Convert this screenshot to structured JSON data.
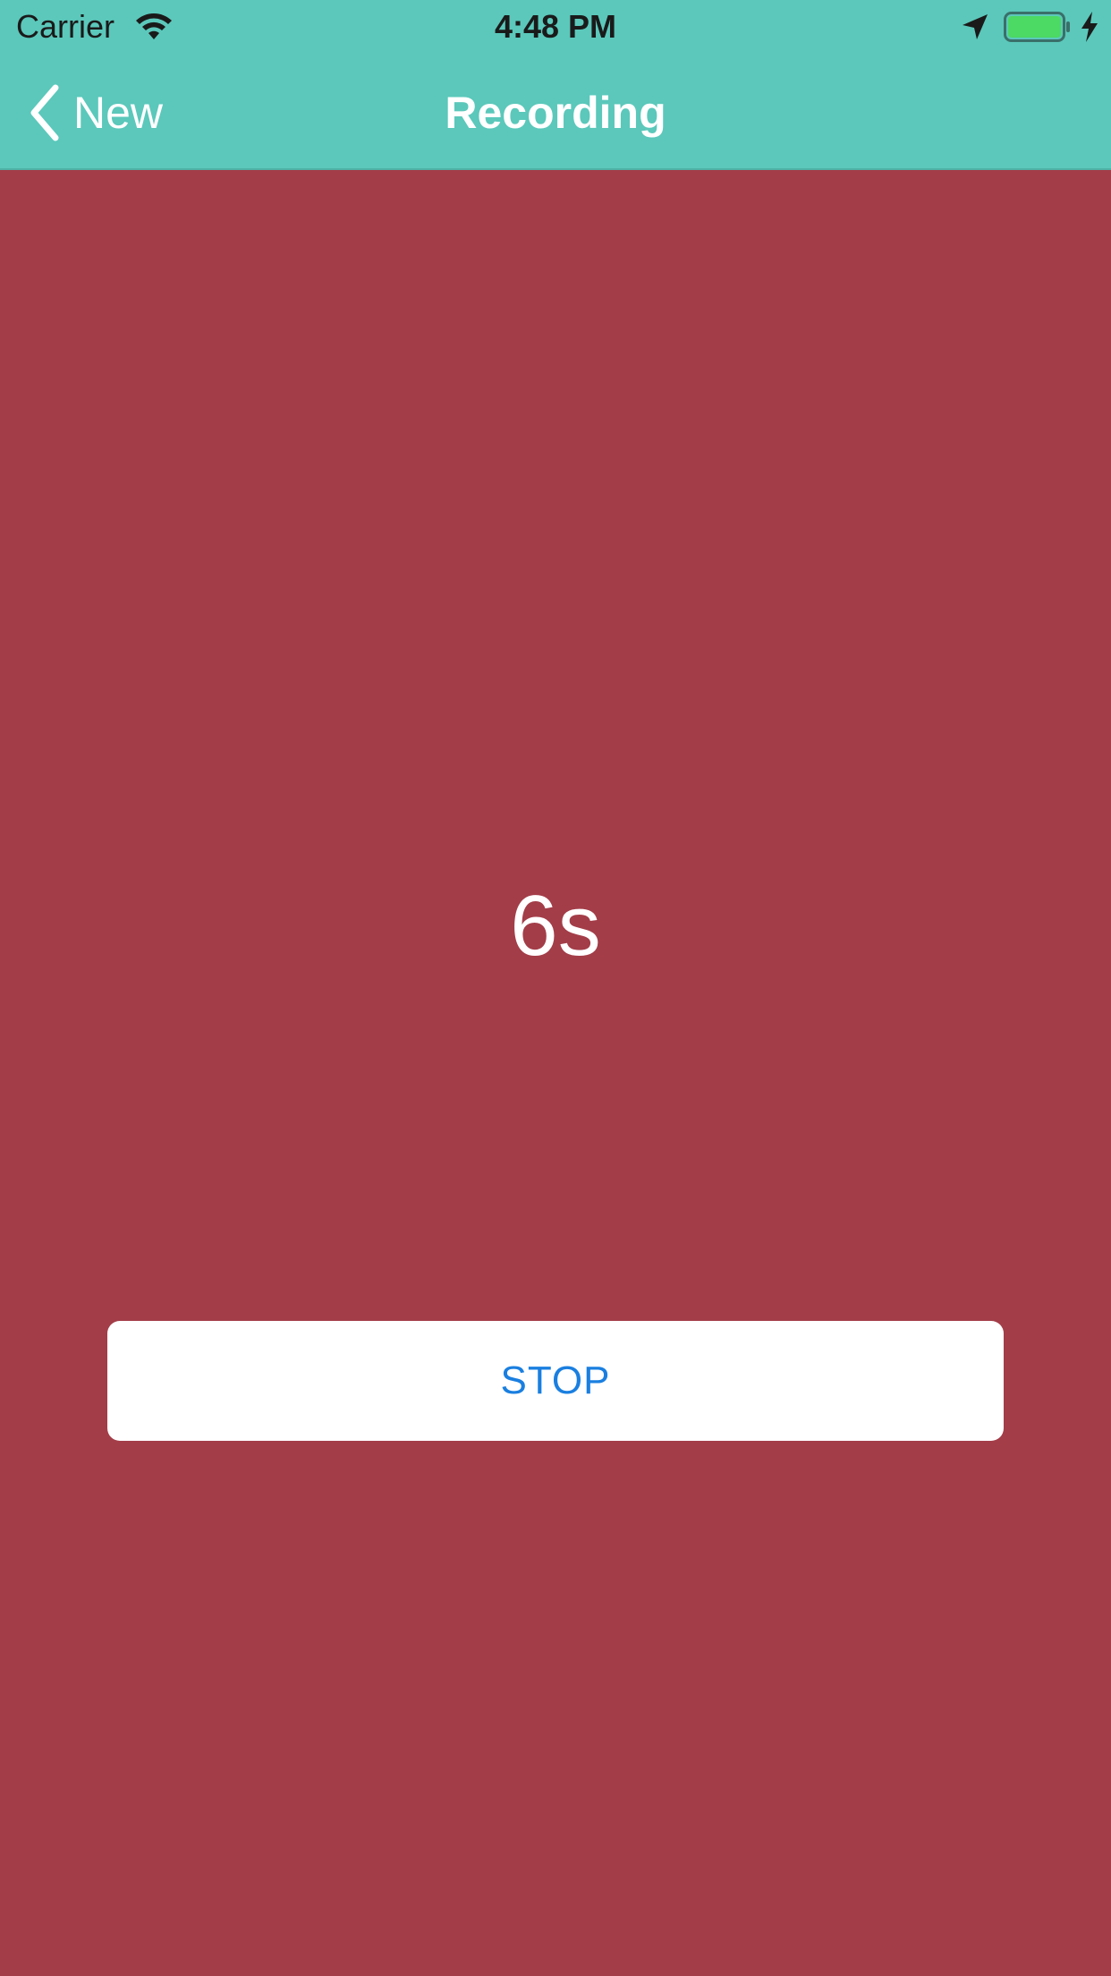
{
  "status_bar": {
    "carrier": "Carrier",
    "time": "4:48 PM",
    "icons": [
      "wifi-icon",
      "location-arrow-icon",
      "battery-icon",
      "charging-bolt-icon"
    ],
    "battery_level": 1.0
  },
  "nav": {
    "back_label": "New",
    "title": "Recording"
  },
  "main": {
    "timer": "6s",
    "stop_label": "STOP"
  },
  "colors": {
    "header": "#5bc8bb",
    "background": "#a33d48",
    "button_bg": "#ffffff",
    "button_text": "#1a7fe0",
    "battery_fill": "#4cd964"
  }
}
